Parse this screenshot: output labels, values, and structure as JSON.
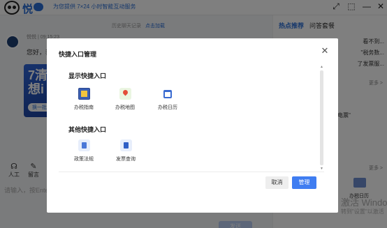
{
  "app": {
    "brand": "悦",
    "slogan": "为您提供 7×24 小时智能互动服务",
    "window_controls": [
      "⤢",
      "⬚",
      "—",
      "✕"
    ]
  },
  "chat": {
    "history_link": "历史聊天记录",
    "history_action": "点击加载",
    "bot_name": "悦悦 | 09:15:23",
    "bot_greeting": "您好，我是",
    "promo_title": "7清\n想i",
    "promo_button": "换一批",
    "tools": [
      {
        "icon": "headset-icon",
        "label": "人工"
      },
      {
        "icon": "edit-icon",
        "label": "留言"
      }
    ],
    "input_placeholder": "请输入，按Enter",
    "send_label": "发送"
  },
  "sidebar": {
    "tabs": [
      "热点推荐",
      "问答套餐"
    ],
    "hot_items": [
      "看不到...",
      "\"税务数...",
      "了发票服..."
    ],
    "more1": "更多 >",
    "hot_item4": "电票\"",
    "more2": "更多 >",
    "calendar_label": "办税日历"
  },
  "watermark": {
    "line1": "激活 Windo",
    "line2": "转到\"设置\"以激活"
  },
  "modal": {
    "title": "快捷入口管理",
    "close_icon": "close-icon",
    "shown_section": "显示快捷入口",
    "shown_entries": [
      {
        "icon": "guide-icon",
        "label": "办税指南"
      },
      {
        "icon": "map-pin-icon",
        "label": "办税地图"
      },
      {
        "icon": "calendar-icon",
        "label": "办税日历"
      }
    ],
    "other_section": "其他快捷入口",
    "other_entries": [
      {
        "icon": "policy-doc-icon",
        "label": "政策法规"
      },
      {
        "icon": "invoice-icon",
        "label": "发票查询"
      }
    ],
    "cancel_label": "取消",
    "manage_label": "管理",
    "colors": {
      "primary": "#3f7df1",
      "cancel_bg": "#eeeeee"
    }
  }
}
